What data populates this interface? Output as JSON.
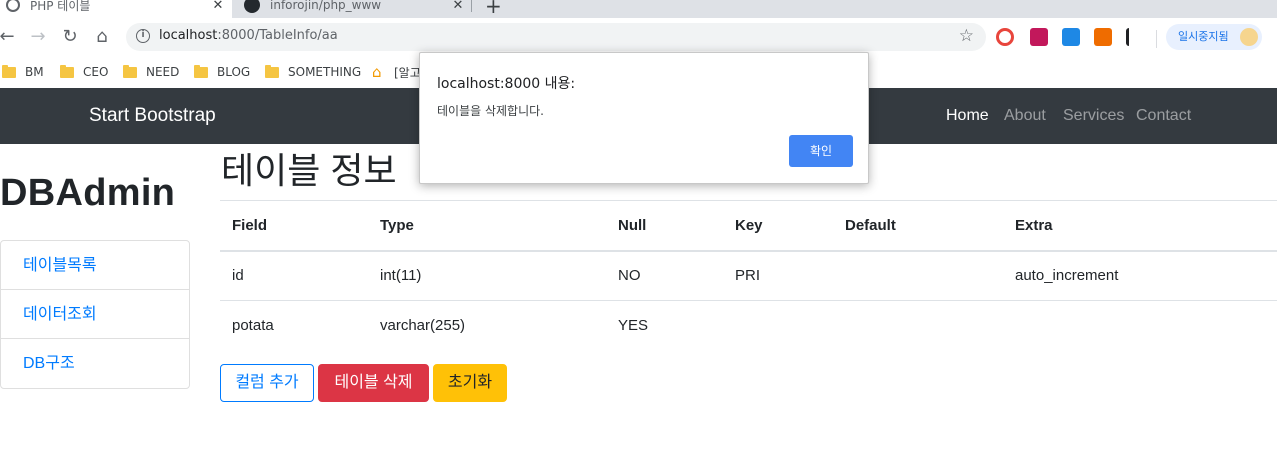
{
  "browser": {
    "tabs": [
      {
        "title": "PHP 테이블",
        "close": "✕"
      },
      {
        "title": "inforojin/php_www",
        "close": "✕"
      }
    ],
    "new_tab": "+",
    "url_host": "localhost",
    "url_rest": ":8000/TableInfo/aa",
    "paused_label": "일시중지됨",
    "bookmarks": [
      "BM",
      "CEO",
      "NEED",
      "BLOG",
      "SOMETHING",
      "[알고"
    ]
  },
  "navbar": {
    "brand": "Start Bootstrap",
    "links": [
      "Home",
      "About",
      "Services",
      "Contact"
    ]
  },
  "sidebar": {
    "title": "DBAdmin",
    "items": [
      "테이블목록",
      "데이터조회",
      "DB구조"
    ]
  },
  "main": {
    "title": "테이블 정보",
    "columns": [
      "Field",
      "Type",
      "Null",
      "Key",
      "Default",
      "Extra"
    ],
    "rows": [
      [
        "id",
        "int(11)",
        "NO",
        "PRI",
        "",
        "auto_increment"
      ],
      [
        "potata",
        "varchar(255)",
        "YES",
        "",
        "",
        ""
      ]
    ],
    "buttons": {
      "add_column": "컬럼 추가",
      "delete_table": "테이블 삭제",
      "reset": "초기화"
    }
  },
  "dialog": {
    "title": "localhost:8000 내용:",
    "message": "테이블을 삭제합니다.",
    "ok": "확인"
  },
  "colors": {
    "navbar_bg": "#343a40",
    "primary": "#007bff",
    "danger": "#dc3545",
    "warning": "#ffc107",
    "dialog_button": "#4285f4"
  }
}
